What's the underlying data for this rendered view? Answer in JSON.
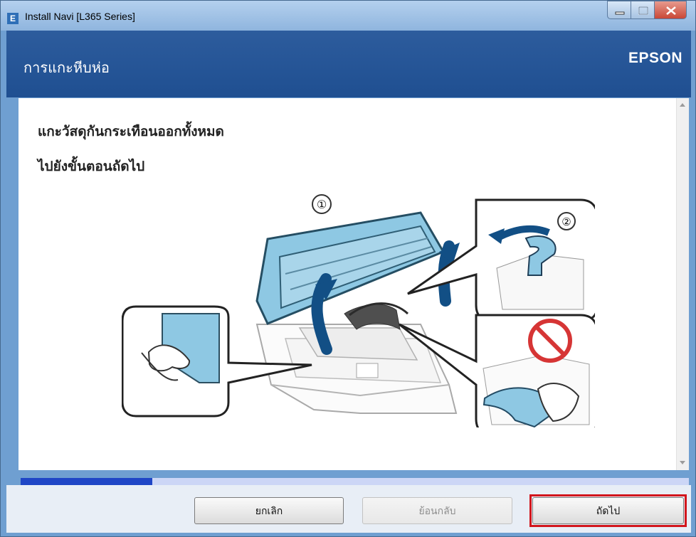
{
  "window": {
    "title": "Install Navi [L365 Series]",
    "controls": [
      "minimize-icon",
      "maximize-icon",
      "close-icon"
    ]
  },
  "header": {
    "page_title": "การแกะหีบห่อ",
    "brand": "EPSON"
  },
  "content": {
    "instructions": [
      "แกะวัสดุกันกระเทือนออกทั้งหมด",
      "ไปยังขั้นตอนถัดไป"
    ],
    "illustration": {
      "step_labels": [
        "①",
        "②"
      ],
      "icons": [
        "printer-lid-open-icon",
        "remove-tape-icon",
        "prohibited-icon"
      ]
    }
  },
  "progress": {
    "value": 0.197
  },
  "footer": {
    "buttons": {
      "cancel": "ยกเลิก",
      "back": "ย้อนกลับ",
      "next": "ถัดไป"
    }
  },
  "colors": {
    "header_blue": "#2d5c9d",
    "progress_blue": "#1f46c6",
    "highlight_red": "#d2161d",
    "illustration_blue": "#8ec8e3"
  }
}
